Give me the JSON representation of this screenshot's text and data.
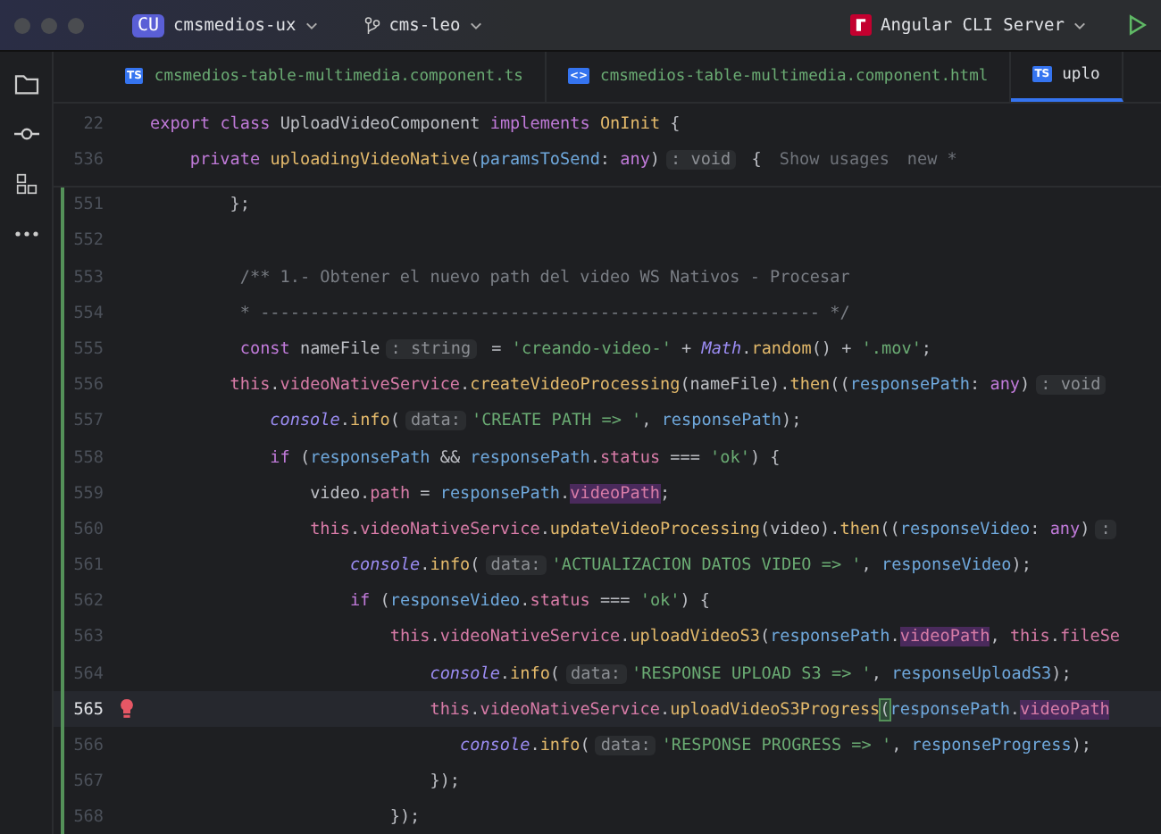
{
  "title_bar": {
    "project_badge": "CU",
    "project": "cmsmedios-ux",
    "branch": "cms-leo",
    "run_config": "Angular CLI Server"
  },
  "tabs": [
    {
      "label": "cmsmedios-table-multimedia.component.ts",
      "icon": "TS",
      "modified": true,
      "selected": false
    },
    {
      "label": "cmsmedios-table-multimedia.component.html",
      "icon": "<>",
      "modified": true,
      "selected": false
    },
    {
      "label": "uplo",
      "icon": "TS",
      "modified": false,
      "selected": true
    }
  ],
  "sticky_lines": [
    {
      "number": "22",
      "tokens": [
        {
          "text": "export",
          "kind": "kw"
        },
        {
          "text": " class",
          "kind": "kw"
        },
        {
          "text": " UploadVideoComponent ",
          "kind": "plain"
        },
        {
          "text": "implements",
          "kind": "kw"
        },
        {
          "text": " OnInit",
          "kind": "type"
        },
        {
          "text": " {",
          "kind": "plain"
        }
      ]
    },
    {
      "number": "536",
      "tokens": [
        {
          "text": "    private",
          "kind": "kw"
        },
        {
          "text": " uploadingVideoNative",
          "kind": "fn"
        },
        {
          "text": "(",
          "kind": "plain"
        },
        {
          "text": "paramsToSend",
          "kind": "param"
        },
        {
          "text": ": ",
          "kind": "plain"
        },
        {
          "text": "any",
          "kind": "kw"
        },
        {
          "text": ")",
          "kind": "plain"
        },
        {
          "text": ": void",
          "kind": "hint"
        },
        {
          "text": " {",
          "kind": "plain"
        },
        {
          "text": "Show usages",
          "kind": "vision"
        },
        {
          "text": "new *",
          "kind": "vision"
        }
      ]
    }
  ],
  "lines": [
    {
      "number": "551",
      "modified": true,
      "current": false,
      "tokens": [
        {
          "text": "        };",
          "kind": "plain"
        }
      ]
    },
    {
      "number": "552",
      "modified": true,
      "current": false
    },
    {
      "number": "553",
      "modified": true,
      "current": false,
      "tokens": [
        {
          "text": "         /** 1.- Obtener el nuevo path del video WS Nativos - Procesar",
          "kind": "comment"
        }
      ]
    },
    {
      "number": "554",
      "modified": true,
      "current": false,
      "tokens": [
        {
          "text": "         * -------------------------------------------------------- */",
          "kind": "comment"
        }
      ]
    },
    {
      "number": "555",
      "modified": true,
      "current": false,
      "tokens": [
        {
          "text": "         const",
          "kind": "kw"
        },
        {
          "text": " nameFile",
          "kind": "plain"
        },
        {
          "text": ": string",
          "kind": "hint"
        },
        {
          "text": " = ",
          "kind": "plain"
        },
        {
          "text": "'creando-video-'",
          "kind": "str"
        },
        {
          "text": " + ",
          "kind": "plain"
        },
        {
          "text": "Math",
          "kind": "global"
        },
        {
          "text": ".",
          "kind": "plain"
        },
        {
          "text": "random",
          "kind": "fn"
        },
        {
          "text": "() + ",
          "kind": "plain"
        },
        {
          "text": "'.mov'",
          "kind": "str"
        },
        {
          "text": ";",
          "kind": "plain"
        }
      ]
    },
    {
      "number": "556",
      "modified": true,
      "current": false,
      "tokens": [
        {
          "text": "        this",
          "kind": "field"
        },
        {
          "text": ".",
          "kind": "plain"
        },
        {
          "text": "videoNativeService",
          "kind": "field"
        },
        {
          "text": ".",
          "kind": "plain"
        },
        {
          "text": "createVideoProcessing",
          "kind": "fn"
        },
        {
          "text": "(nameFile).",
          "kind": "plain"
        },
        {
          "text": "then",
          "kind": "fn"
        },
        {
          "text": "((",
          "kind": "plain"
        },
        {
          "text": "responsePath",
          "kind": "param"
        },
        {
          "text": ": ",
          "kind": "plain"
        },
        {
          "text": "any",
          "kind": "kw"
        },
        {
          "text": ")",
          "kind": "plain"
        },
        {
          "text": ": void",
          "kind": "hint"
        }
      ]
    },
    {
      "number": "557",
      "modified": true,
      "current": false,
      "tokens": [
        {
          "text": "            console",
          "kind": "global"
        },
        {
          "text": ".",
          "kind": "plain"
        },
        {
          "text": "info",
          "kind": "fn"
        },
        {
          "text": "(",
          "kind": "plain"
        },
        {
          "text": "data:",
          "kind": "hint"
        },
        {
          "text": "'CREATE PATH => '",
          "kind": "str"
        },
        {
          "text": ", ",
          "kind": "plain"
        },
        {
          "text": "responsePath",
          "kind": "param"
        },
        {
          "text": ");",
          "kind": "plain"
        }
      ]
    },
    {
      "number": "558",
      "modified": true,
      "current": false,
      "tokens": [
        {
          "text": "            if",
          "kind": "kw"
        },
        {
          "text": " (",
          "kind": "plain"
        },
        {
          "text": "responsePath",
          "kind": "param"
        },
        {
          "text": " && ",
          "kind": "plain"
        },
        {
          "text": "responsePath",
          "kind": "param"
        },
        {
          "text": ".",
          "kind": "plain"
        },
        {
          "text": "status",
          "kind": "prop"
        },
        {
          "text": " === ",
          "kind": "plain"
        },
        {
          "text": "'ok'",
          "kind": "str"
        },
        {
          "text": ") {",
          "kind": "plain"
        }
      ]
    },
    {
      "number": "559",
      "modified": true,
      "current": false,
      "tokens": [
        {
          "text": "                video.",
          "kind": "plain"
        },
        {
          "text": "path",
          "kind": "prop"
        },
        {
          "text": " = ",
          "kind": "plain"
        },
        {
          "text": "responsePath",
          "kind": "param"
        },
        {
          "text": ".",
          "kind": "plain"
        },
        {
          "text": "videoPath",
          "kind": "match"
        },
        {
          "text": ";",
          "kind": "plain"
        }
      ]
    },
    {
      "number": "560",
      "modified": true,
      "current": false,
      "tokens": [
        {
          "text": "                this",
          "kind": "field"
        },
        {
          "text": ".",
          "kind": "plain"
        },
        {
          "text": "videoNativeService",
          "kind": "field"
        },
        {
          "text": ".",
          "kind": "plain"
        },
        {
          "text": "updateVideoProcessing",
          "kind": "fn"
        },
        {
          "text": "(video).",
          "kind": "plain"
        },
        {
          "text": "then",
          "kind": "fn"
        },
        {
          "text": "((",
          "kind": "plain"
        },
        {
          "text": "responseVideo",
          "kind": "param"
        },
        {
          "text": ": ",
          "kind": "plain"
        },
        {
          "text": "any",
          "kind": "kw"
        },
        {
          "text": ")",
          "kind": "plain"
        },
        {
          "text": ":",
          "kind": "hint"
        }
      ]
    },
    {
      "number": "561",
      "modified": true,
      "current": false,
      "tokens": [
        {
          "text": "                    console",
          "kind": "global"
        },
        {
          "text": ".",
          "kind": "plain"
        },
        {
          "text": "info",
          "kind": "fn"
        },
        {
          "text": "(",
          "kind": "plain"
        },
        {
          "text": "data:",
          "kind": "hint"
        },
        {
          "text": "'ACTUALIZACION DATOS VIDEO => '",
          "kind": "str"
        },
        {
          "text": ", ",
          "kind": "plain"
        },
        {
          "text": "responseVideo",
          "kind": "param"
        },
        {
          "text": ");",
          "kind": "plain"
        }
      ]
    },
    {
      "number": "562",
      "modified": true,
      "current": false,
      "tokens": [
        {
          "text": "                    if",
          "kind": "kw"
        },
        {
          "text": " (",
          "kind": "plain"
        },
        {
          "text": "responseVideo",
          "kind": "param"
        },
        {
          "text": ".",
          "kind": "plain"
        },
        {
          "text": "status",
          "kind": "prop"
        },
        {
          "text": " === ",
          "kind": "plain"
        },
        {
          "text": "'ok'",
          "kind": "str"
        },
        {
          "text": ") {",
          "kind": "plain"
        }
      ]
    },
    {
      "number": "563",
      "modified": true,
      "current": false,
      "tokens": [
        {
          "text": "                        this",
          "kind": "field"
        },
        {
          "text": ".",
          "kind": "plain"
        },
        {
          "text": "videoNativeService",
          "kind": "field"
        },
        {
          "text": ".",
          "kind": "plain"
        },
        {
          "text": "uploadVideoS3",
          "kind": "fn"
        },
        {
          "text": "(",
          "kind": "plain"
        },
        {
          "text": "responsePath",
          "kind": "param"
        },
        {
          "text": ".",
          "kind": "plain"
        },
        {
          "text": "videoPath",
          "kind": "match"
        },
        {
          "text": ", ",
          "kind": "plain"
        },
        {
          "text": "this",
          "kind": "field"
        },
        {
          "text": ".",
          "kind": "plain"
        },
        {
          "text": "fileSe",
          "kind": "field"
        }
      ]
    },
    {
      "number": "564",
      "modified": true,
      "current": false,
      "tokens": [
        {
          "text": "                            console",
          "kind": "global"
        },
        {
          "text": ".",
          "kind": "plain"
        },
        {
          "text": "info",
          "kind": "fn"
        },
        {
          "text": "(",
          "kind": "plain"
        },
        {
          "text": "data:",
          "kind": "hint"
        },
        {
          "text": "'RESPONSE UPLOAD S3 => '",
          "kind": "str"
        },
        {
          "text": ", ",
          "kind": "plain"
        },
        {
          "text": "responseUploadS3",
          "kind": "param"
        },
        {
          "text": ");",
          "kind": "plain"
        }
      ]
    },
    {
      "number": "565",
      "modified": true,
      "current": true,
      "bulb": true,
      "tokens": [
        {
          "text": "                            this",
          "kind": "field"
        },
        {
          "text": ".",
          "kind": "plain"
        },
        {
          "text": "videoNativeService",
          "kind": "field"
        },
        {
          "text": ".",
          "kind": "plain"
        },
        {
          "text": "uploadVideoS3Progress",
          "kind": "fn"
        },
        {
          "text": "(",
          "kind": "bracket"
        },
        {
          "text": "responsePath",
          "kind": "param"
        },
        {
          "text": ".",
          "kind": "plain"
        },
        {
          "text": "videoPath",
          "kind": "match"
        }
      ]
    },
    {
      "number": "566",
      "modified": true,
      "current": false,
      "tokens": [
        {
          "text": "                               console",
          "kind": "global"
        },
        {
          "text": ".",
          "kind": "plain"
        },
        {
          "text": "info",
          "kind": "fn"
        },
        {
          "text": "(",
          "kind": "plain"
        },
        {
          "text": "data:",
          "kind": "hint"
        },
        {
          "text": "'RESPONSE PROGRESS => '",
          "kind": "str"
        },
        {
          "text": ", ",
          "kind": "plain"
        },
        {
          "text": "responseProgress",
          "kind": "param"
        },
        {
          "text": ");",
          "kind": "plain"
        }
      ]
    },
    {
      "number": "567",
      "modified": true,
      "current": false,
      "tokens": [
        {
          "text": "                            });",
          "kind": "plain"
        }
      ]
    },
    {
      "number": "568",
      "modified": true,
      "current": false,
      "tokens": [
        {
          "text": "                        });",
          "kind": "plain"
        }
      ]
    }
  ]
}
